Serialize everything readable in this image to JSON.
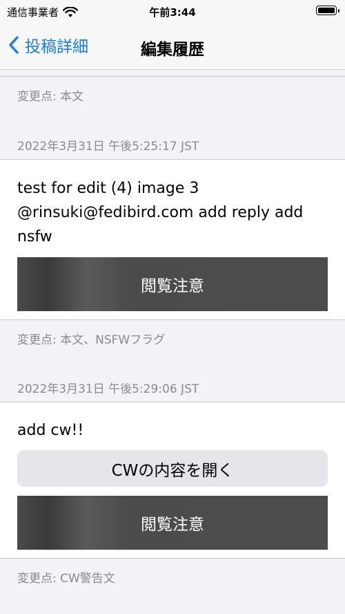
{
  "status_bar": {
    "carrier": "通信事業者",
    "time": "午前3:44"
  },
  "nav": {
    "back_label": "投稿詳細",
    "title": "編集履歴"
  },
  "entries": [
    {
      "changes": "変更点: 本文"
    },
    {
      "timestamp": "2022年3月31日 午後5:25:17 JST",
      "text": "test for edit (4) image 3 @rinsuki@fedibird.com add reply add nsfw",
      "nsfw_label": "閲覧注意",
      "changes": "変更点: 本文、NSFWフラグ"
    },
    {
      "timestamp": "2022年3月31日 午後5:29:06 JST",
      "text": "add cw!!",
      "cw_button": "CWの内容を開く",
      "nsfw_label": "閲覧注意",
      "changes": "変更点: CW警告文"
    }
  ],
  "colors": {
    "accent": "#1a7cf5",
    "meta_text": "#8a8a8e",
    "background": "#f2f2f7",
    "nsfw_bg": "#4b4b4b"
  }
}
